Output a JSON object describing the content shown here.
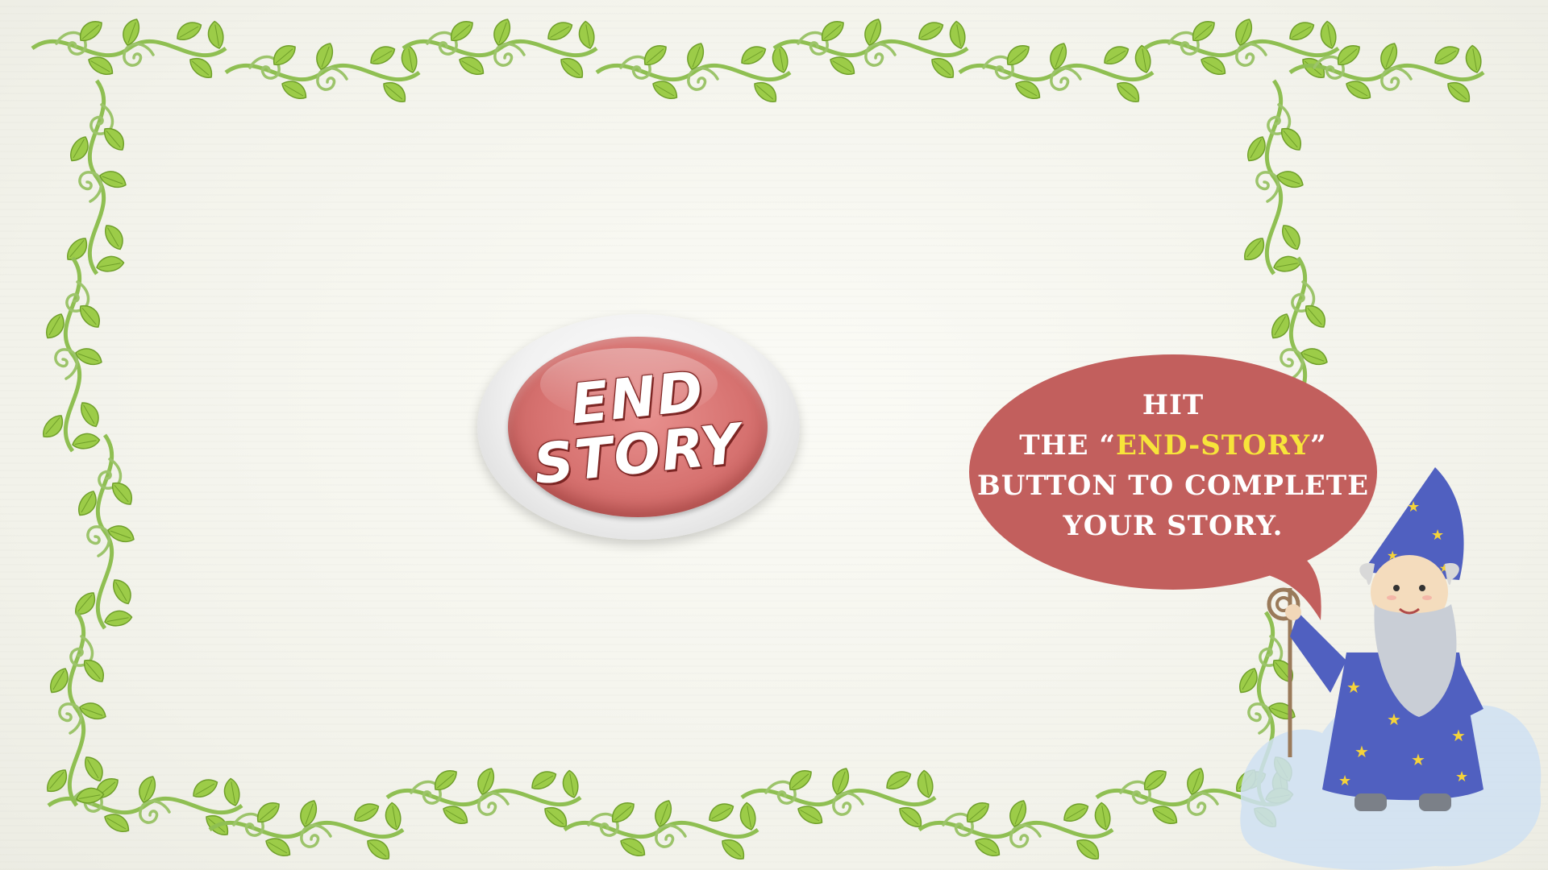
{
  "end_button": {
    "line1": "END",
    "line2": "STORY"
  },
  "speech_bubble": {
    "line1": "HIT",
    "line2_prefix": "THE “",
    "line2_highlight": "END-STORY",
    "line2_suffix": "”",
    "line3": "BUTTON TO COMPLETE",
    "line4": "YOUR STORY."
  },
  "colors": {
    "button_red": "#d6716f",
    "bubble": "#c25f5d",
    "highlight_yellow": "#f7e43a",
    "vine_green": "#8cc63f",
    "wizard_robe": "#5060c0"
  },
  "icons": {
    "frame": "floral-vine-border",
    "character": "wizard-with-staff"
  }
}
